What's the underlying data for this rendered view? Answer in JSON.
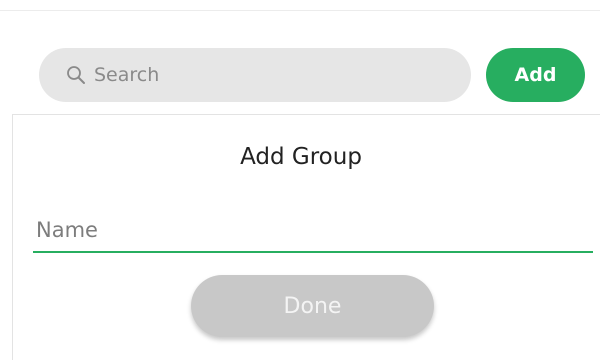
{
  "search": {
    "placeholder": "Search",
    "icon": "search-icon"
  },
  "toolbar": {
    "add_label": "Add"
  },
  "dialog": {
    "title": "Add Group",
    "name_placeholder": "Name",
    "done_label": "Done"
  },
  "colors": {
    "accent": "#27ae60",
    "search_bg": "#e6e6e6",
    "done_disabled_bg": "#c8c8c8"
  }
}
